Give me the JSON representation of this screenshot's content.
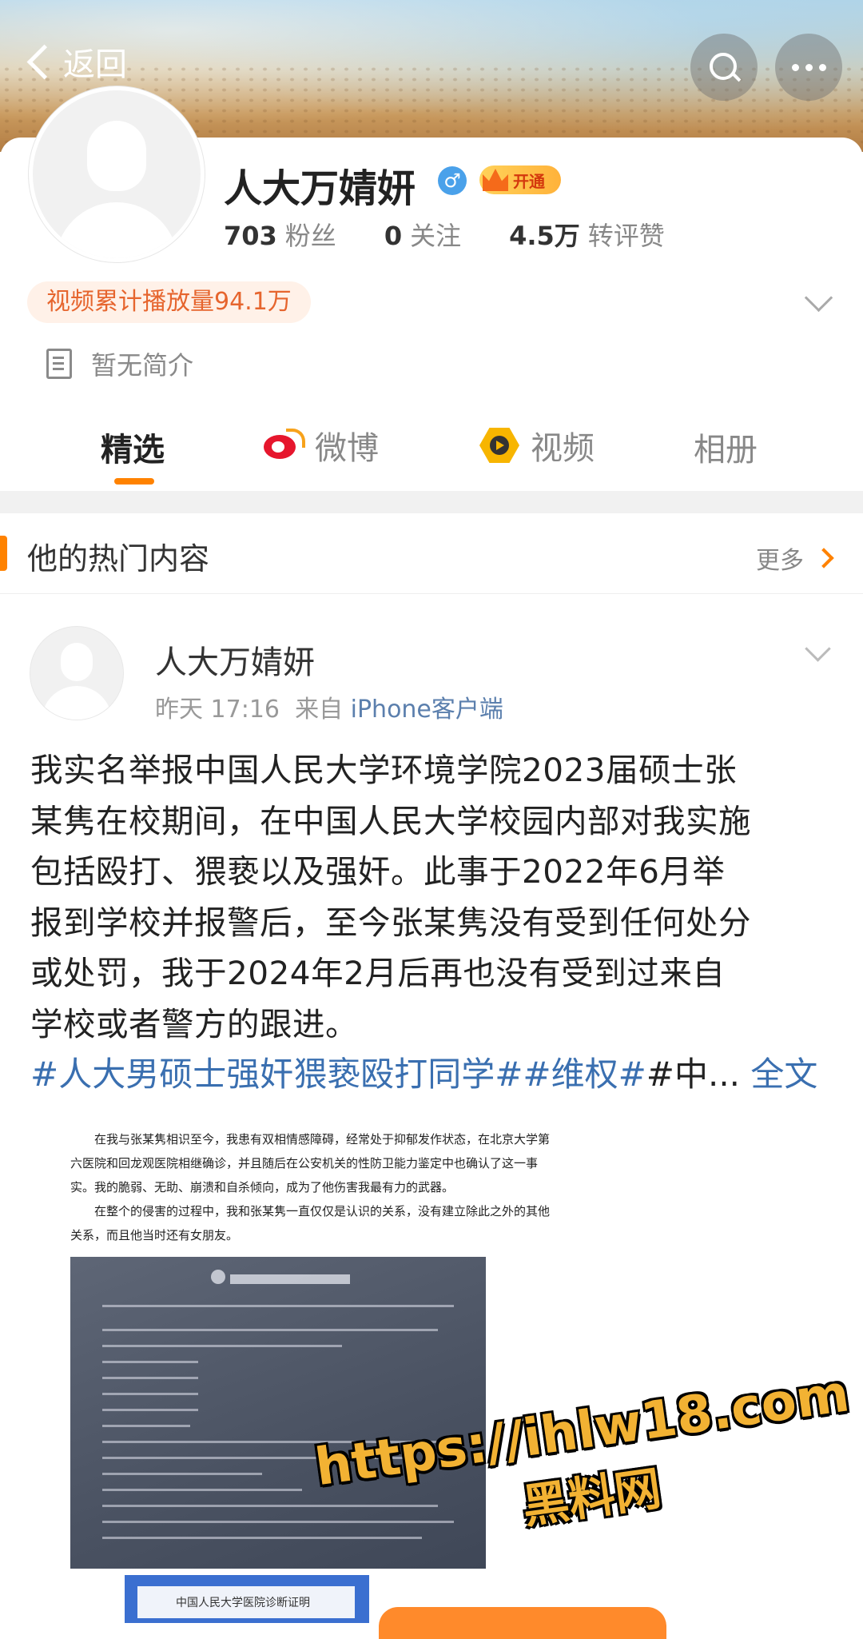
{
  "nav": {
    "back_label": "返回"
  },
  "profile": {
    "name": "人大万婧妍",
    "vip_label": "开通",
    "stats": [
      {
        "value": "703",
        "label": "粉丝"
      },
      {
        "value": "0",
        "label": "关注"
      },
      {
        "value": "4.5万",
        "label": "转评赞"
      }
    ],
    "play_count": "视频累计播放量94.1万",
    "intro": "暂无简介"
  },
  "tabs": [
    {
      "label": "精选"
    },
    {
      "label": "微博"
    },
    {
      "label": "视频"
    },
    {
      "label": "相册"
    }
  ],
  "hot_section": {
    "title": "他的热门内容",
    "more_label": "更多"
  },
  "post": {
    "author": "人大万婧妍",
    "time": "昨天 17:16",
    "source_prefix": "来自",
    "source": "iPhone客户端",
    "lines": [
      "我实名举报中国人民大学环境学院2023届硕士张",
      "某隽在校期间，在中国人民大学校园内部对我实施",
      "包括殴打、猥亵以及强奸。此事于2022年6月举",
      "报到学校并报警后，至今张某隽没有受到任何处分",
      "或处罚，我于2024年2月后再也没有受到过来自",
      "学校或者警方的跟进。"
    ],
    "tags": "#人大男硕士强奸猥亵殴打同学##维权#",
    "tag_tail": "#中...",
    "full_text_label": "全文",
    "image_paragraphs": [
      "在我与张某隽相识至今，我患有双相情感障碍，经常处于抑郁发作状态，在北京大学第六医院和回龙观医院相继确诊，并且随后在公安机关的性防卫能力鉴定中也确认了这一事实。我的脆弱、无助、崩溃和自杀倾向，成为了他伤害我最有力的武器。",
      "在整个的侵害的过程中，我和张某隽一直仅仅是认识的关系，没有建立除此之外的其他关系，而且他当时还有女朋友。"
    ],
    "image_doc_caption": "中国人民大学医院诊断证明"
  },
  "watermark": {
    "url": "https://ihlw18.com",
    "name": "黑料网"
  },
  "colors": {
    "accent": "#ff8200",
    "link": "#3a6fb0",
    "pill_bg": "#fff1e8",
    "pill_text": "#e6652e"
  }
}
